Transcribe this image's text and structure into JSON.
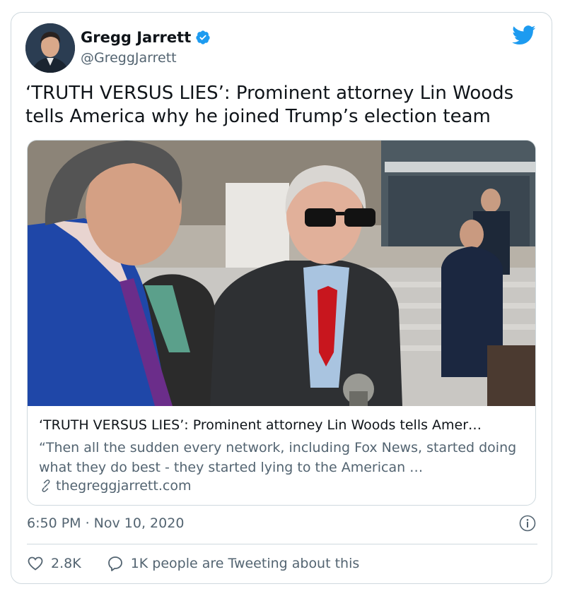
{
  "author": {
    "name": "Gregg Jarrett",
    "handle": "@GreggJarrett"
  },
  "tweet": {
    "text": "‘TRUTH VERSUS LIES’: Prominent attorney Lin Woods tells America why he joined Trump’s election team"
  },
  "link_card": {
    "title": "‘TRUTH VERSUS LIES’: Prominent attorney Lin Woods tells Amer…",
    "description": "“Then all the sudden every network, including Fox News, started doing what they do best - they started lying to the American …",
    "domain": "thegreggjarrett.com"
  },
  "meta": {
    "timestamp": "6:50 PM · Nov 10, 2020"
  },
  "actions": {
    "likes": "2.8K",
    "conversation": "1K people are Tweeting about this"
  },
  "colors": {
    "twitter_blue": "#1d9bf0",
    "text_primary": "#0f1419",
    "text_secondary": "#536471",
    "border": "#cfd9de"
  },
  "icons": [
    "verified-badge-icon",
    "twitter-bird-icon",
    "link-icon",
    "info-icon",
    "heart-icon",
    "reply-bubble-icon"
  ]
}
